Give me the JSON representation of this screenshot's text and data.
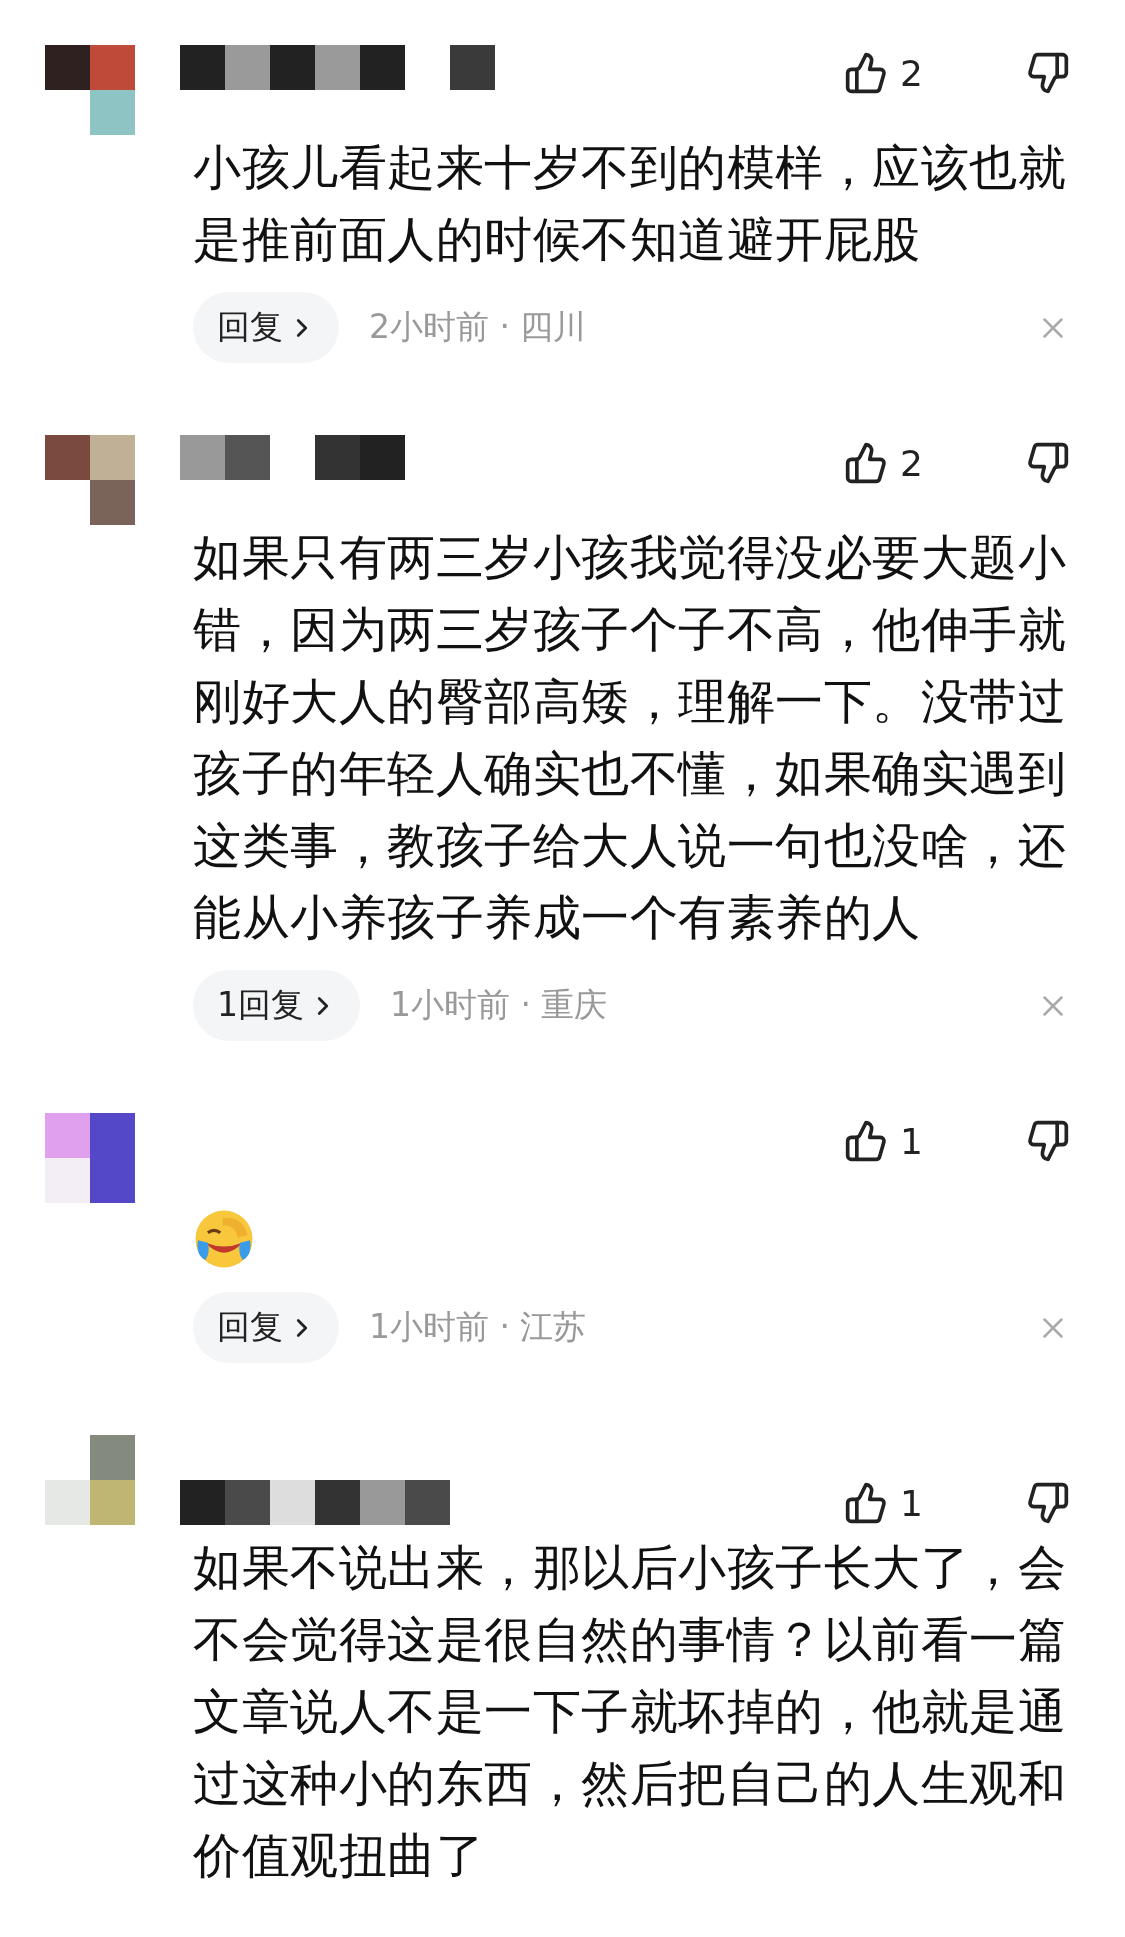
{
  "comments": [
    {
      "kind": "text",
      "likes": "2",
      "body": "小孩儿看起来十岁不到的模样，应该也就是推前面人的时候不知道避开屁股",
      "reply_label": "回复",
      "meta": "2小时前 · 四川"
    },
    {
      "kind": "text",
      "likes": "2",
      "body": "如果只有两三岁小孩我觉得没必要大题小错，因为两三岁孩子个子不高，他伸手就刚好大人的臀部高矮，理解一下。没带过孩子的年轻人确实也不懂，如果确实遇到这类事，教孩子给大人说一句也没啥，还能从小养孩子养成一个有素养的人",
      "reply_label": "1回复",
      "meta": "1小时前 · 重庆"
    },
    {
      "kind": "emoji",
      "likes": "1",
      "reply_label": "回复",
      "meta": "1小时前 · 江苏"
    },
    {
      "kind": "text",
      "likes": "1",
      "body": "如果不说出来，那以后小孩子长大了，会不会觉得这是很自然的事情？以前看一篇文章说人不是一下子就坏掉的，他就是通过这种小的东西，然后把自己的人生观和价值观扭曲了"
    }
  ]
}
